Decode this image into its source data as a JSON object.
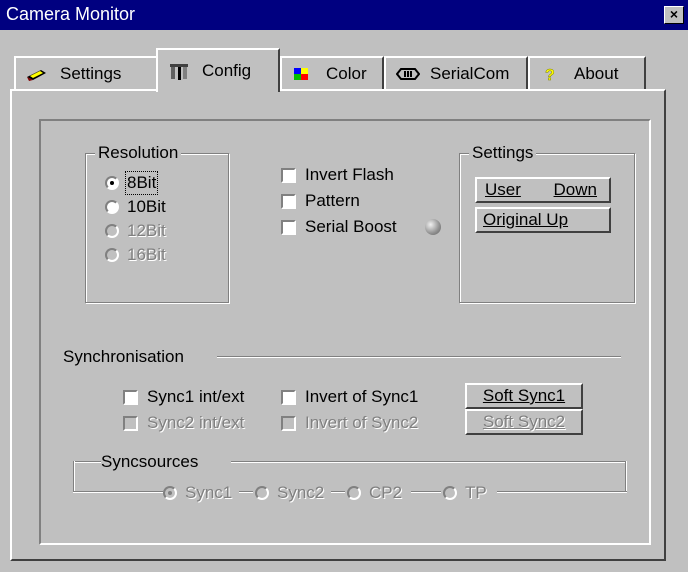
{
  "window": {
    "title": "Camera Monitor",
    "close_glyph": "×"
  },
  "tabs": [
    {
      "label": "Settings",
      "icon": "pen-icon"
    },
    {
      "label": "Config",
      "icon": "tools-icon"
    },
    {
      "label": "Color",
      "icon": "color-icon"
    },
    {
      "label": "SerialCom",
      "icon": "connector-icon"
    },
    {
      "label": "About",
      "icon": "question-icon"
    }
  ],
  "active_tab": "Config",
  "resolution": {
    "title": "Resolution",
    "options": [
      {
        "label": "8Bit",
        "selected": true,
        "enabled": true
      },
      {
        "label": "10Bit",
        "selected": false,
        "enabled": true
      },
      {
        "label": "12Bit",
        "selected": false,
        "enabled": false
      },
      {
        "label": "16Bit",
        "selected": false,
        "enabled": false
      }
    ]
  },
  "options": {
    "invert_flash": {
      "label": "Invert Flash",
      "checked": false
    },
    "pattern": {
      "label": "Pattern",
      "checked": false
    },
    "serial_boost": {
      "label": "Serial Boost",
      "checked": false
    }
  },
  "settings_group": {
    "title": "Settings",
    "user_down": {
      "left": "User",
      "right": "Down"
    },
    "original_up": "Original Up"
  },
  "synchronisation": {
    "title": "Synchronisation",
    "sync1_int_ext": "Sync1 int/ext",
    "invert_sync1": "Invert of Sync1",
    "soft_sync1": "Soft Sync1",
    "sync2_int_ext": "Sync2 int/ext",
    "invert_sync2": "Invert of Sync2",
    "soft_sync2": "Soft Sync2"
  },
  "syncsources": {
    "title": "Syncsources",
    "options": [
      {
        "label": "Sync1",
        "selected": true
      },
      {
        "label": "Sync2",
        "selected": false
      },
      {
        "label": "CP2",
        "selected": false
      },
      {
        "label": "TP",
        "selected": false
      }
    ]
  }
}
